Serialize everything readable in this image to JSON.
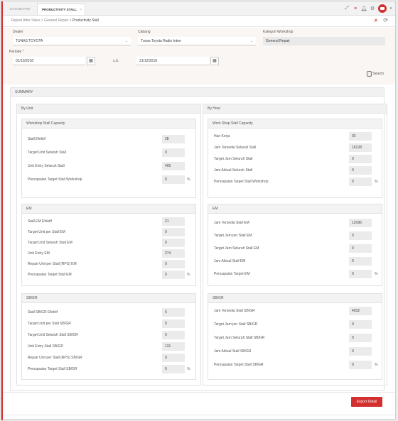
{
  "tabs": [
    {
      "label": "DASHBOARD"
    },
    {
      "label": "PRODUCTIVITY STALL",
      "close": "×"
    }
  ],
  "breadcrumb": {
    "parts": [
      "Report After Sales",
      "General Repair",
      "Productivity Stall"
    ],
    "sep": " > "
  },
  "filters": {
    "dealer_label": "Dealer",
    "dealer_value": "TUNAS TOYOTA",
    "cabang_label": "Cabang",
    "cabang_value": "Tunas Toyota Radin Inten",
    "kategori_label": "Kategori Workshop",
    "kategori_value": "General Repair",
    "periode_label": "Periode",
    "required_mark": "*",
    "date_from": "01/10/2018",
    "sd_label": "s.d.",
    "date_to": "21/12/2018",
    "search_label": "Search"
  },
  "summary": {
    "title": "SUMMARY",
    "by_unit": {
      "title": "By Unit",
      "workshop": {
        "title": "Workshop Stall Capacity",
        "rows": [
          {
            "label": "Stall Efektif",
            "value": "28"
          },
          {
            "label": "Target Unit Seluruh Stall",
            "value": "0"
          },
          {
            "label": "Unit Entry Seluruh Stall",
            "value": "405"
          },
          {
            "label": "Pencapaian Target Stall Workshop",
            "value": "0",
            "unit": "%"
          }
        ]
      },
      "em": {
        "title": "EM",
        "rows": [
          {
            "label": "Stall EM Efektif",
            "value": "21"
          },
          {
            "label": "Target Unit per Stall EM",
            "value": "0"
          },
          {
            "label": "Target Unit Seluruh Stall EM",
            "value": "0"
          },
          {
            "label": "Unit Entry EM",
            "value": "274"
          },
          {
            "label": "Repair Unit per Stall (RPS) EM",
            "value": "0"
          },
          {
            "label": "Pencapaian Target Stall EM",
            "value": "0",
            "unit": "%"
          }
        ]
      },
      "sbgr": {
        "title": "SB/GR",
        "rows": [
          {
            "label": "Stall SB/GR Efektif",
            "value": "6"
          },
          {
            "label": "Target Unit per Stall SB/GR",
            "value": "0"
          },
          {
            "label": "Target Unit Seluruh Stall SB/GR",
            "value": "0"
          },
          {
            "label": "Unit Entry Stall SB/GR",
            "value": "131"
          },
          {
            "label": "Repair Unit per Stall (RPS) SB/GR",
            "value": "0"
          },
          {
            "label": "Pencapaian Target Stall SB/GR",
            "value": "0",
            "unit": "%"
          }
        ]
      }
    },
    "by_hour": {
      "title": "By Hour",
      "workshop": {
        "title": "Work Shop Stall Capacity",
        "rows": [
          {
            "label": "Hari Kerja",
            "value": "92"
          },
          {
            "label": "Jam Tersedia Seluruh Stall",
            "value": "16128"
          },
          {
            "label": "Target Jam Seluruh Stall",
            "value": "0"
          },
          {
            "label": "Jam Aktual Seluruh Stall",
            "value": "0"
          },
          {
            "label": "Pencapaian Target Stall Workshop",
            "value": "0",
            "unit": "%"
          }
        ]
      },
      "em": {
        "title": "EM",
        "rows": [
          {
            "label": "Jam Tersedia Stall EM",
            "value": "12096"
          },
          {
            "label": "Target Jam per Stall EM",
            "value": "0"
          },
          {
            "label": "Target Jam Seluruh Stall EM",
            "value": "0"
          },
          {
            "label": "Jam Aktual Stall EM",
            "value": "0"
          },
          {
            "label": "Pencapaian Target EM",
            "value": "0",
            "unit": "%"
          }
        ]
      },
      "sbgr": {
        "title": "SB/GR",
        "rows": [
          {
            "label": "Jam Tersedia Stall SB/GR",
            "value": "4032"
          },
          {
            "label": "Target Jam per Stall SB/GR",
            "value": "0"
          },
          {
            "label": "Target Jam Seluruh Stall SB/GR",
            "value": "0"
          },
          {
            "label": "Jam Aktual Stall SB/GR",
            "value": "0"
          },
          {
            "label": "Pencapaian Target Stall SB/GR",
            "value": "0",
            "unit": "%"
          }
        ]
      }
    }
  },
  "actions": {
    "export_label": "Export Detail"
  },
  "icons": {
    "expand": "expand-icon",
    "menu": "menu-icon",
    "bell": "bell-icon",
    "settings": "gear-icon",
    "avatar": "avatar-icon",
    "search": "search-icon",
    "refresh": "refresh-icon",
    "calendar": "calendar-icon",
    "database": "database-icon"
  },
  "colors": {
    "accent": "#d32f2f"
  }
}
